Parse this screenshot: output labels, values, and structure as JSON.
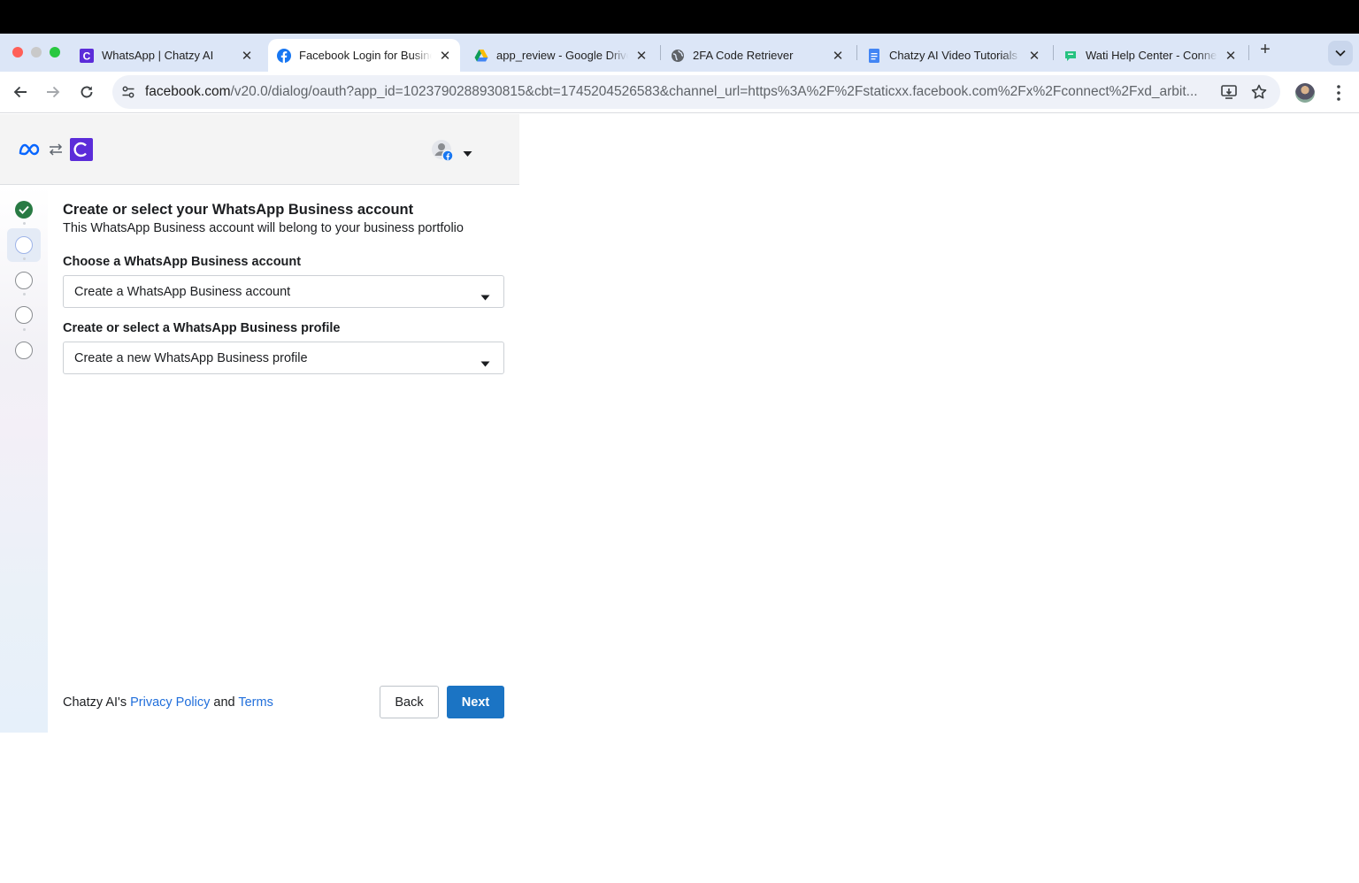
{
  "browser": {
    "tabs": [
      {
        "title": "WhatsApp | Chatzy AI",
        "favicon": "chatzy-logo-icon",
        "active": false
      },
      {
        "title": "Facebook Login for Business",
        "favicon": "facebook-icon",
        "active": true
      },
      {
        "title": "app_review - Google Drive",
        "favicon": "google-drive-icon",
        "active": false
      },
      {
        "title": "2FA Code Retriever",
        "favicon": "globe-icon",
        "active": false
      },
      {
        "title": "Chatzy AI Video Tutorials",
        "favicon": "google-docs-icon",
        "active": false
      },
      {
        "title": "Wati Help Center - Connect",
        "favicon": "wati-icon",
        "active": false
      }
    ],
    "close_glyph": "✕",
    "new_tab_glyph": "+",
    "address": {
      "host": "facebook.com",
      "path": "/v20.0/dialog/oauth?app_id=1023790288930815&cbt=1745204526583&channel_url=https%3A%2F%2Fstaticxx.facebook.com%2Fx%2Fconnect%2Fxd_arbit..."
    }
  },
  "dialog": {
    "title": "Create or select your WhatsApp Business account",
    "subtitle": "This WhatsApp Business account will belong to your business portfolio",
    "fields": [
      {
        "label": "Choose a WhatsApp Business account",
        "value": "Create a WhatsApp Business account"
      },
      {
        "label": "Create or select a WhatsApp Business profile",
        "value": "Create a new WhatsApp Business profile"
      }
    ],
    "steps": [
      {
        "state": "done"
      },
      {
        "state": "current"
      },
      {
        "state": "pending"
      },
      {
        "state": "pending"
      },
      {
        "state": "pending"
      }
    ],
    "footer": {
      "prefix": "Chatzy AI's ",
      "privacy_link": "Privacy Policy",
      "and": " and ",
      "terms_link": "Terms"
    },
    "back_label": "Back",
    "next_label": "Next"
  },
  "colors": {
    "accent_blue": "#1b74c4",
    "link_blue": "#216fdb",
    "done_green": "#287a43",
    "chatzy_purple": "#5b2cd9"
  }
}
